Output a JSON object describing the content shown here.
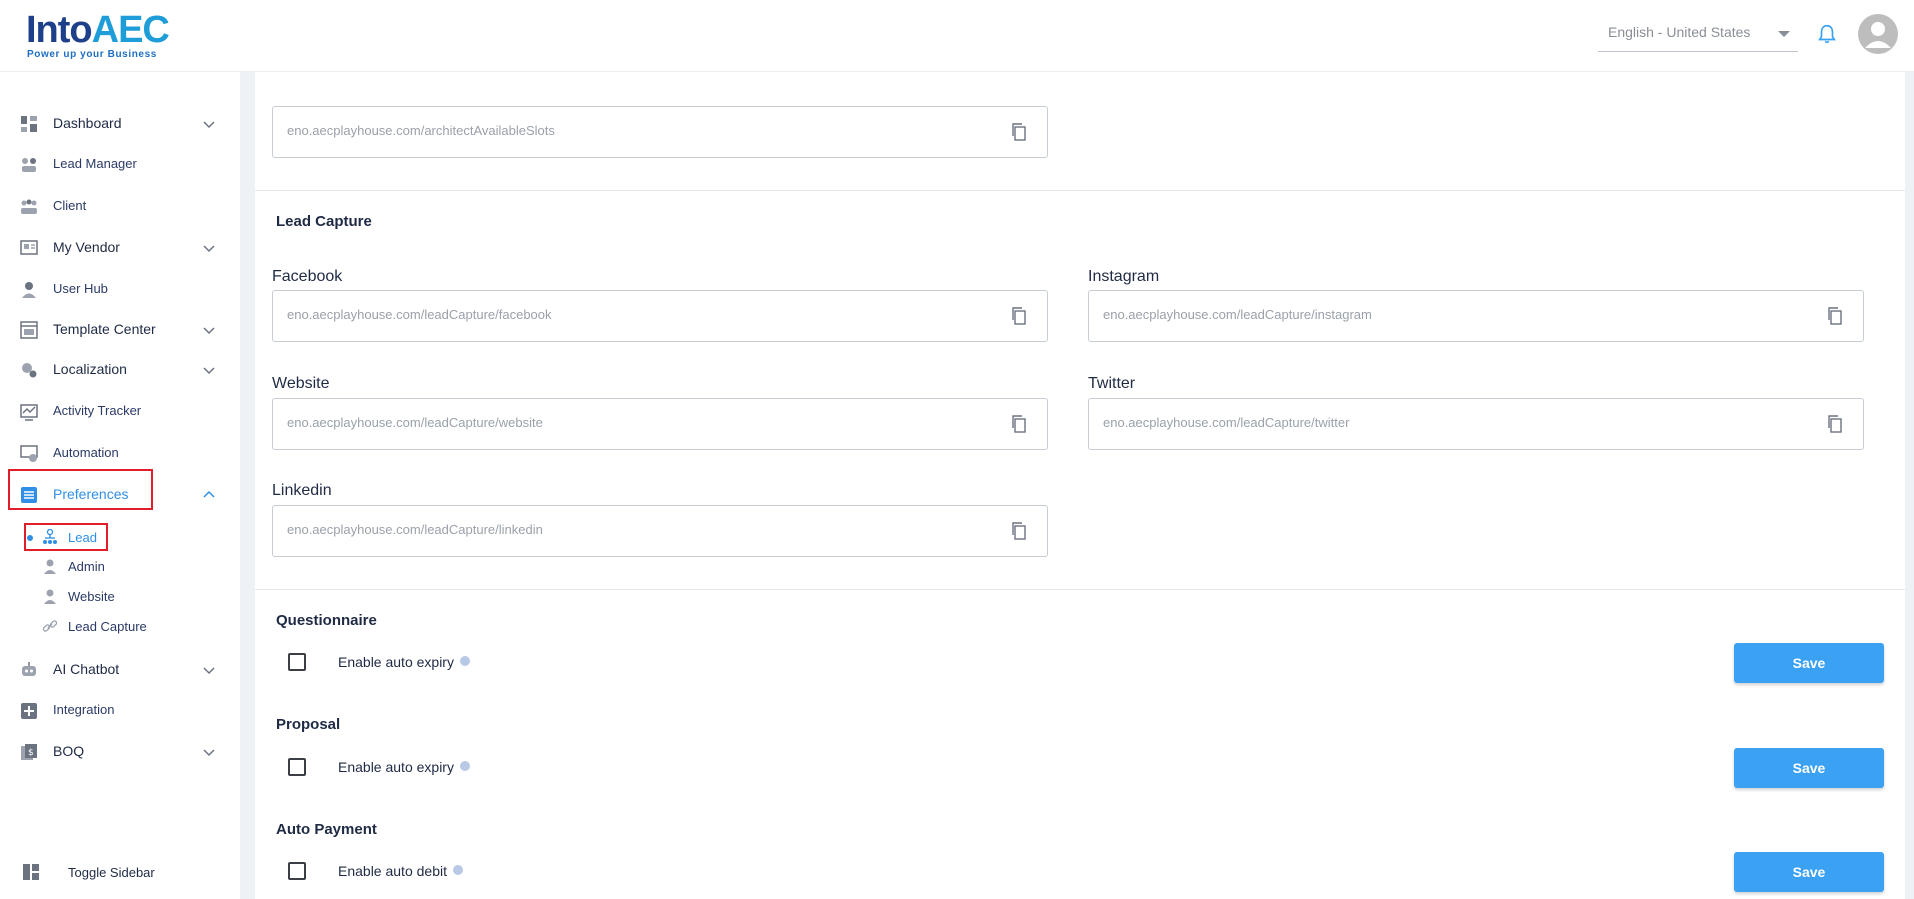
{
  "header": {
    "logo_main": "Into",
    "logo_accent": "AEC",
    "logo_tagline": "Power up your Business",
    "language": "English - United States"
  },
  "sidebar": {
    "items": [
      {
        "label": "Dashboard",
        "icon": "dashboard-icon",
        "chevron": "down"
      },
      {
        "label": "Lead Manager",
        "icon": "lead-manager-icon"
      },
      {
        "label": "Client",
        "icon": "client-icon"
      },
      {
        "label": "My Vendor",
        "icon": "vendor-icon",
        "chevron": "down"
      },
      {
        "label": "User Hub",
        "icon": "user-icon"
      },
      {
        "label": "Template Center",
        "icon": "template-icon",
        "chevron": "down"
      },
      {
        "label": "Localization",
        "icon": "localization-icon",
        "chevron": "down"
      },
      {
        "label": "Activity Tracker",
        "icon": "activity-icon"
      },
      {
        "label": "Automation",
        "icon": "automation-icon"
      },
      {
        "label": "Preferences",
        "icon": "preferences-icon",
        "chevron": "up"
      },
      {
        "label": "AI Chatbot",
        "icon": "chatbot-icon",
        "chevron": "down"
      },
      {
        "label": "Integration",
        "icon": "integration-icon"
      },
      {
        "label": "BOQ",
        "icon": "boq-icon",
        "chevron": "down"
      }
    ],
    "sub_items": [
      {
        "label": "Lead",
        "icon": "lead-icon"
      },
      {
        "label": "Admin",
        "icon": "admin-icon"
      },
      {
        "label": "Website",
        "icon": "website-icon"
      },
      {
        "label": "Lead Capture",
        "icon": "link-icon"
      }
    ],
    "toggle_label": "Toggle Sidebar"
  },
  "main": {
    "top_field": "eno.aecplayhouse.com/architectAvailableSlots",
    "lead_capture": {
      "title": "Lead Capture",
      "facebook_label": "Facebook",
      "facebook_value": "eno.aecplayhouse.com/leadCapture/facebook",
      "instagram_label": "Instagram",
      "instagram_value": "eno.aecplayhouse.com/leadCapture/instagram",
      "website_label": "Website",
      "website_value": "eno.aecplayhouse.com/leadCapture/website",
      "twitter_label": "Twitter",
      "twitter_value": "eno.aecplayhouse.com/leadCapture/twitter",
      "linkedin_label": "Linkedin",
      "linkedin_value": "eno.aecplayhouse.com/leadCapture/linkedin"
    },
    "questionnaire": {
      "title": "Questionnaire",
      "checkbox_label": "Enable auto expiry",
      "save": "Save"
    },
    "proposal": {
      "title": "Proposal",
      "checkbox_label": "Enable auto expiry",
      "save": "Save"
    },
    "auto_payment": {
      "title": "Auto Payment",
      "checkbox_label": "Enable auto debit",
      "save": "Save"
    }
  },
  "colors": {
    "accent": "#3ba1f2",
    "highlight": "#e11d2a",
    "brand": "#1e3f8a"
  }
}
